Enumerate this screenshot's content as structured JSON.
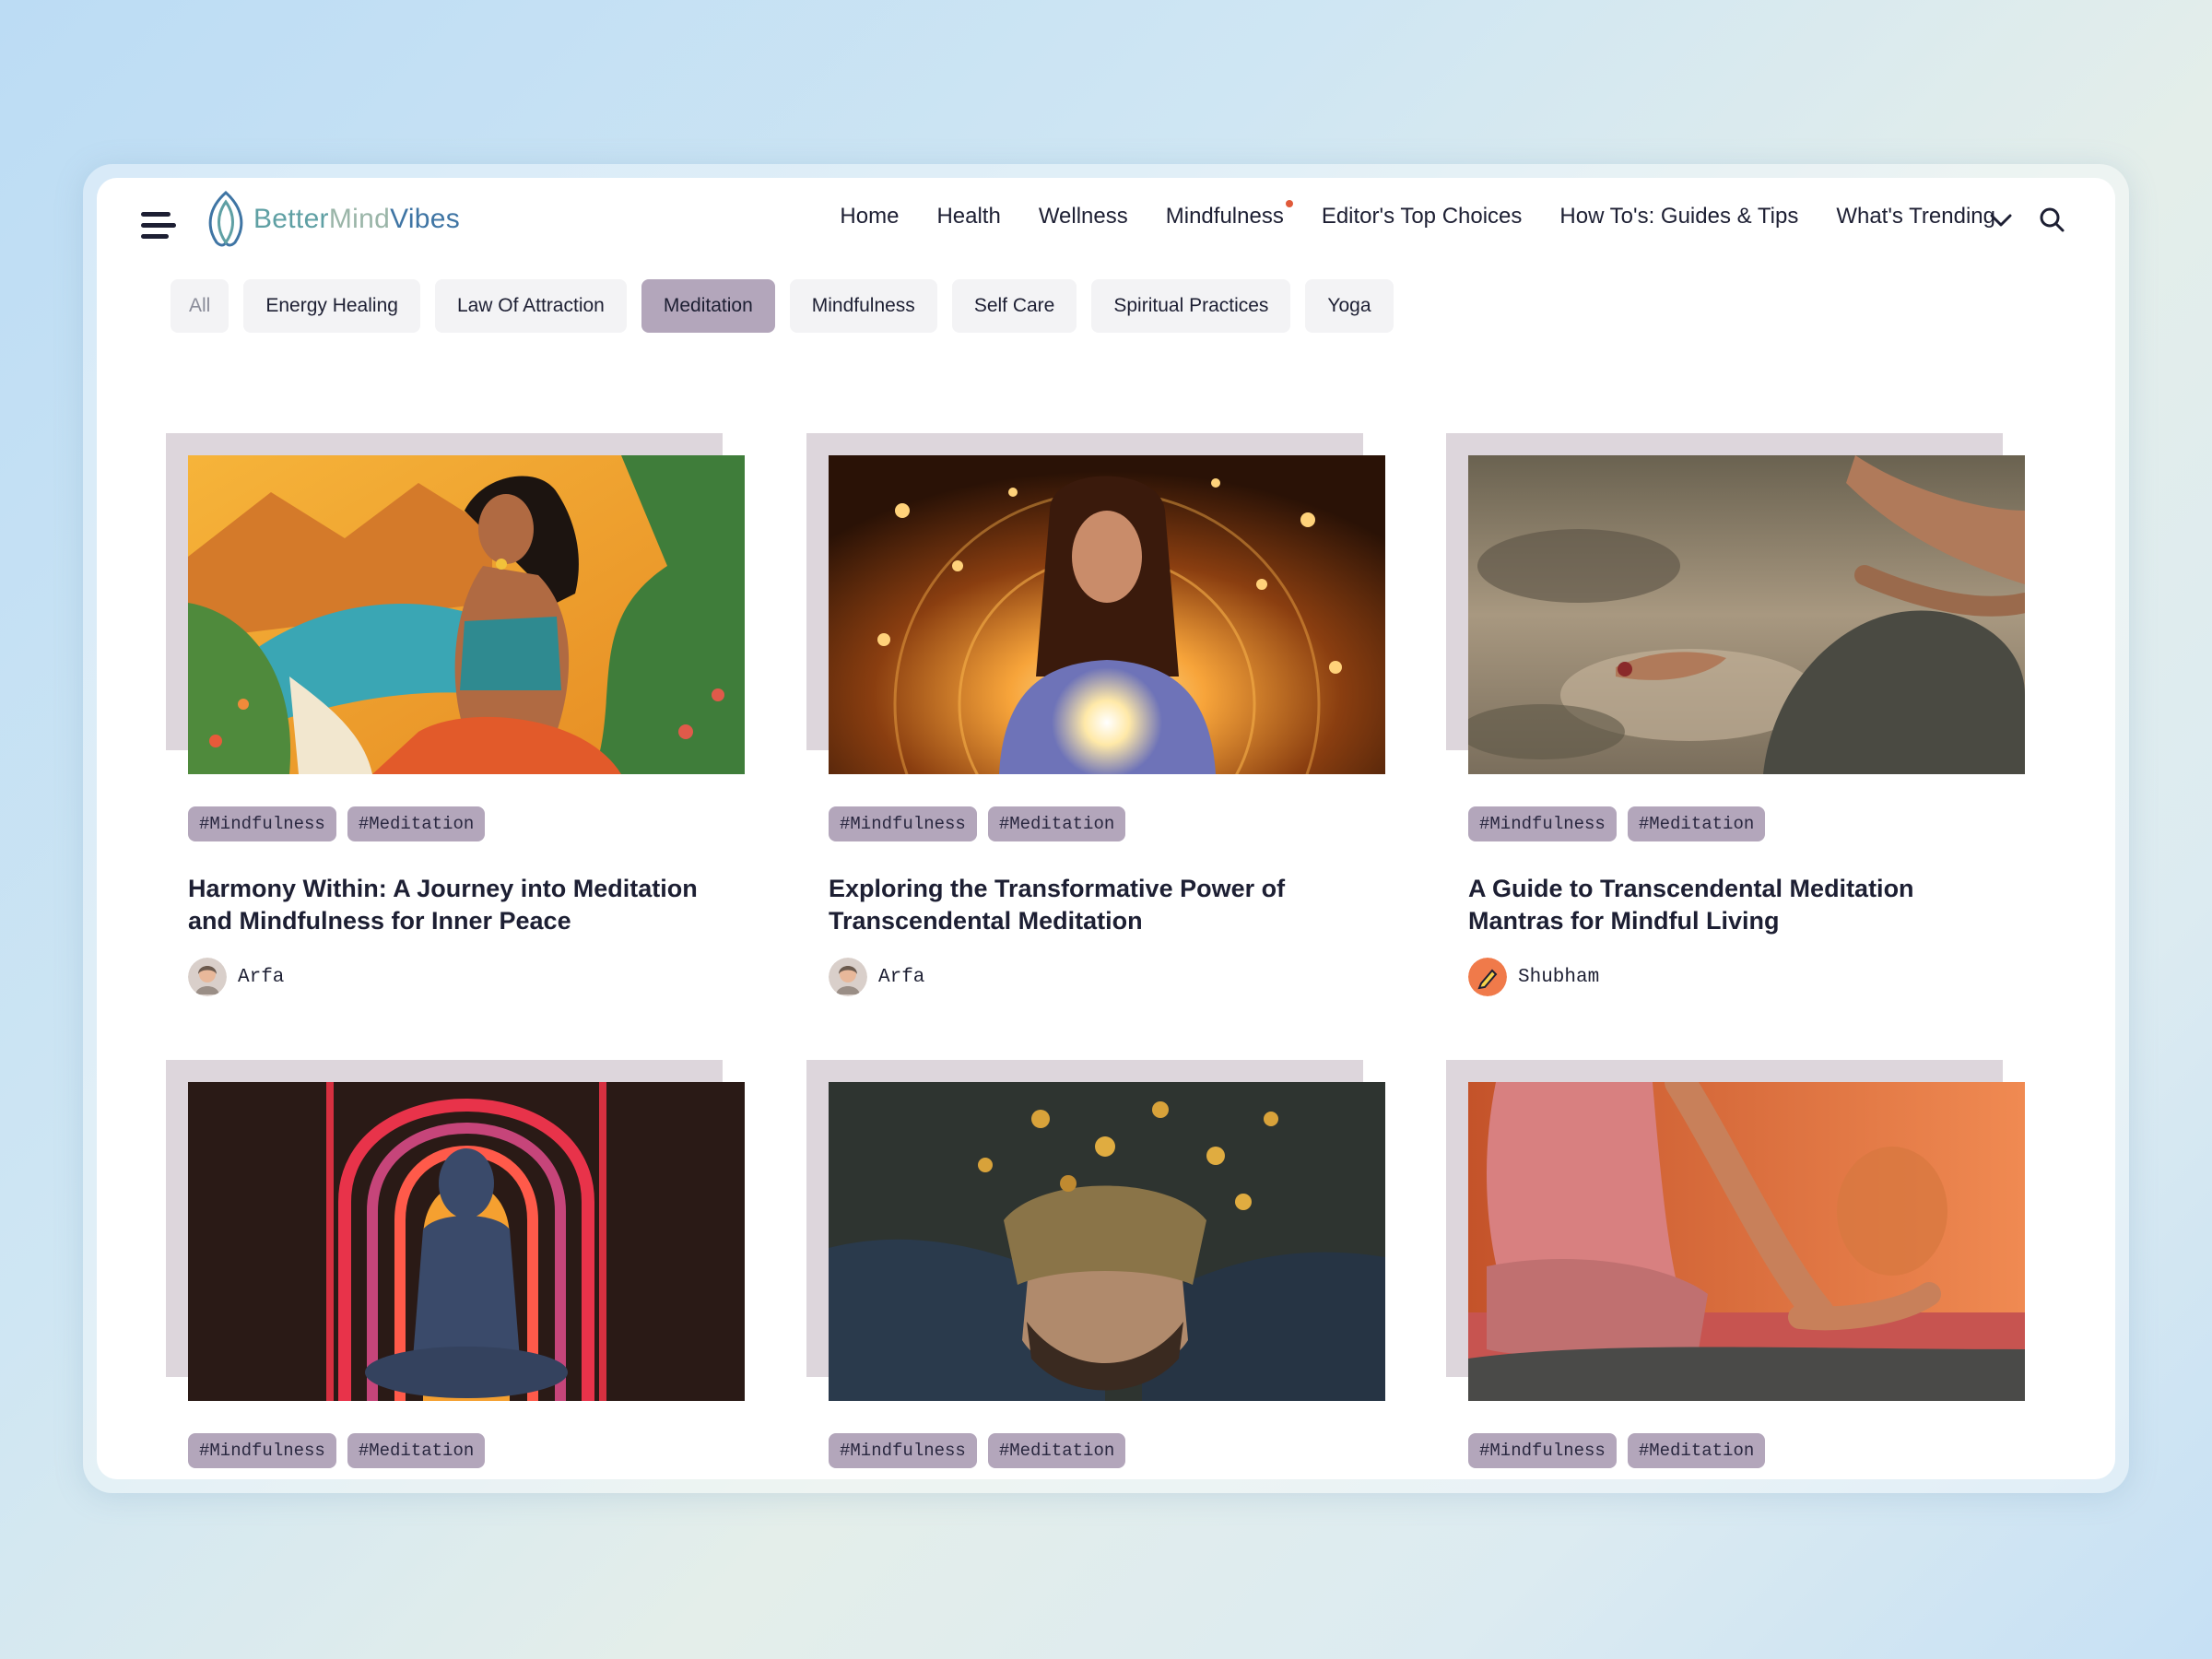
{
  "brand": {
    "part1": "Better",
    "part2": "Mind",
    "part3": "Vibes"
  },
  "nav": {
    "items": [
      {
        "label": "Home"
      },
      {
        "label": "Health"
      },
      {
        "label": "Wellness"
      },
      {
        "label": "Mindfulness"
      },
      {
        "label": "Editor's Top Choices"
      },
      {
        "label": "How To's: Guides & Tips"
      },
      {
        "label": "What's Trending"
      }
    ],
    "more_icon": "chevron-down-icon",
    "search_icon": "search-icon"
  },
  "categories": {
    "items": [
      "All",
      "Energy Healing",
      "Law Of Attraction",
      "Meditation",
      "Mindfulness",
      "Self Care",
      "Spiritual Practices",
      "Yoga"
    ],
    "active": "Meditation"
  },
  "cards": [
    {
      "tags": [
        "#Mindfulness",
        "#Meditation"
      ],
      "title": "Harmony Within: A Journey into Meditation and Mindfulness for Inner Peace",
      "author": "Arfa"
    },
    {
      "tags": [
        "#Mindfulness",
        "#Meditation"
      ],
      "title": "Exploring the Transformative Power of Transcendental Meditation",
      "author": "Arfa"
    },
    {
      "tags": [
        "#Mindfulness",
        "#Meditation"
      ],
      "title": "A Guide to Transcendental Meditation Mantras for Mindful Living",
      "author": "Shubham"
    },
    {
      "tags": [
        "#Mindfulness",
        "#Meditation"
      ]
    },
    {
      "tags": [
        "#Mindfulness",
        "#Meditation"
      ]
    },
    {
      "tags": [
        "#Mindfulness",
        "#Meditation"
      ]
    }
  ],
  "colors": {
    "accent": "#b3a6bb",
    "text": "#1d1f33",
    "notification_dot": "#e05a3a",
    "image_backdrop": "#ddd6dc"
  }
}
